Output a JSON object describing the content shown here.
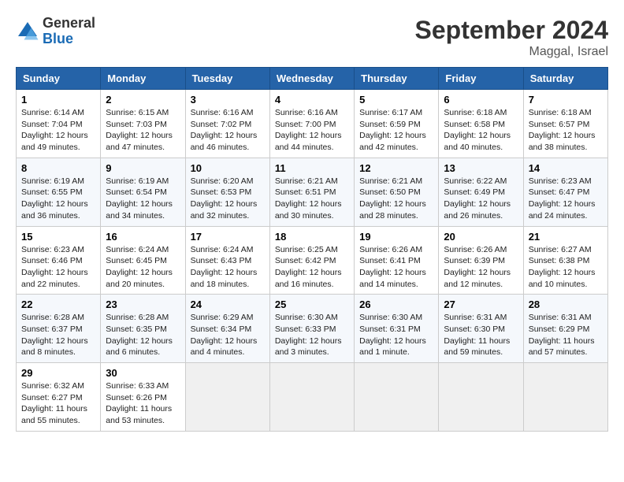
{
  "header": {
    "logo_general": "General",
    "logo_blue": "Blue",
    "month_title": "September 2024",
    "location": "Maggal, Israel"
  },
  "days_of_week": [
    "Sunday",
    "Monday",
    "Tuesday",
    "Wednesday",
    "Thursday",
    "Friday",
    "Saturday"
  ],
  "weeks": [
    [
      {
        "day": "1",
        "info": "Sunrise: 6:14 AM\nSunset: 7:04 PM\nDaylight: 12 hours\nand 49 minutes."
      },
      {
        "day": "2",
        "info": "Sunrise: 6:15 AM\nSunset: 7:03 PM\nDaylight: 12 hours\nand 47 minutes."
      },
      {
        "day": "3",
        "info": "Sunrise: 6:16 AM\nSunset: 7:02 PM\nDaylight: 12 hours\nand 46 minutes."
      },
      {
        "day": "4",
        "info": "Sunrise: 6:16 AM\nSunset: 7:00 PM\nDaylight: 12 hours\nand 44 minutes."
      },
      {
        "day": "5",
        "info": "Sunrise: 6:17 AM\nSunset: 6:59 PM\nDaylight: 12 hours\nand 42 minutes."
      },
      {
        "day": "6",
        "info": "Sunrise: 6:18 AM\nSunset: 6:58 PM\nDaylight: 12 hours\nand 40 minutes."
      },
      {
        "day": "7",
        "info": "Sunrise: 6:18 AM\nSunset: 6:57 PM\nDaylight: 12 hours\nand 38 minutes."
      }
    ],
    [
      {
        "day": "8",
        "info": "Sunrise: 6:19 AM\nSunset: 6:55 PM\nDaylight: 12 hours\nand 36 minutes."
      },
      {
        "day": "9",
        "info": "Sunrise: 6:19 AM\nSunset: 6:54 PM\nDaylight: 12 hours\nand 34 minutes."
      },
      {
        "day": "10",
        "info": "Sunrise: 6:20 AM\nSunset: 6:53 PM\nDaylight: 12 hours\nand 32 minutes."
      },
      {
        "day": "11",
        "info": "Sunrise: 6:21 AM\nSunset: 6:51 PM\nDaylight: 12 hours\nand 30 minutes."
      },
      {
        "day": "12",
        "info": "Sunrise: 6:21 AM\nSunset: 6:50 PM\nDaylight: 12 hours\nand 28 minutes."
      },
      {
        "day": "13",
        "info": "Sunrise: 6:22 AM\nSunset: 6:49 PM\nDaylight: 12 hours\nand 26 minutes."
      },
      {
        "day": "14",
        "info": "Sunrise: 6:23 AM\nSunset: 6:47 PM\nDaylight: 12 hours\nand 24 minutes."
      }
    ],
    [
      {
        "day": "15",
        "info": "Sunrise: 6:23 AM\nSunset: 6:46 PM\nDaylight: 12 hours\nand 22 minutes."
      },
      {
        "day": "16",
        "info": "Sunrise: 6:24 AM\nSunset: 6:45 PM\nDaylight: 12 hours\nand 20 minutes."
      },
      {
        "day": "17",
        "info": "Sunrise: 6:24 AM\nSunset: 6:43 PM\nDaylight: 12 hours\nand 18 minutes."
      },
      {
        "day": "18",
        "info": "Sunrise: 6:25 AM\nSunset: 6:42 PM\nDaylight: 12 hours\nand 16 minutes."
      },
      {
        "day": "19",
        "info": "Sunrise: 6:26 AM\nSunset: 6:41 PM\nDaylight: 12 hours\nand 14 minutes."
      },
      {
        "day": "20",
        "info": "Sunrise: 6:26 AM\nSunset: 6:39 PM\nDaylight: 12 hours\nand 12 minutes."
      },
      {
        "day": "21",
        "info": "Sunrise: 6:27 AM\nSunset: 6:38 PM\nDaylight: 12 hours\nand 10 minutes."
      }
    ],
    [
      {
        "day": "22",
        "info": "Sunrise: 6:28 AM\nSunset: 6:37 PM\nDaylight: 12 hours\nand 8 minutes."
      },
      {
        "day": "23",
        "info": "Sunrise: 6:28 AM\nSunset: 6:35 PM\nDaylight: 12 hours\nand 6 minutes."
      },
      {
        "day": "24",
        "info": "Sunrise: 6:29 AM\nSunset: 6:34 PM\nDaylight: 12 hours\nand 4 minutes."
      },
      {
        "day": "25",
        "info": "Sunrise: 6:30 AM\nSunset: 6:33 PM\nDaylight: 12 hours\nand 3 minutes."
      },
      {
        "day": "26",
        "info": "Sunrise: 6:30 AM\nSunset: 6:31 PM\nDaylight: 12 hours\nand 1 minute."
      },
      {
        "day": "27",
        "info": "Sunrise: 6:31 AM\nSunset: 6:30 PM\nDaylight: 11 hours\nand 59 minutes."
      },
      {
        "day": "28",
        "info": "Sunrise: 6:31 AM\nSunset: 6:29 PM\nDaylight: 11 hours\nand 57 minutes."
      }
    ],
    [
      {
        "day": "29",
        "info": "Sunrise: 6:32 AM\nSunset: 6:27 PM\nDaylight: 11 hours\nand 55 minutes."
      },
      {
        "day": "30",
        "info": "Sunrise: 6:33 AM\nSunset: 6:26 PM\nDaylight: 11 hours\nand 53 minutes."
      },
      {
        "day": "",
        "info": ""
      },
      {
        "day": "",
        "info": ""
      },
      {
        "day": "",
        "info": ""
      },
      {
        "day": "",
        "info": ""
      },
      {
        "day": "",
        "info": ""
      }
    ]
  ]
}
